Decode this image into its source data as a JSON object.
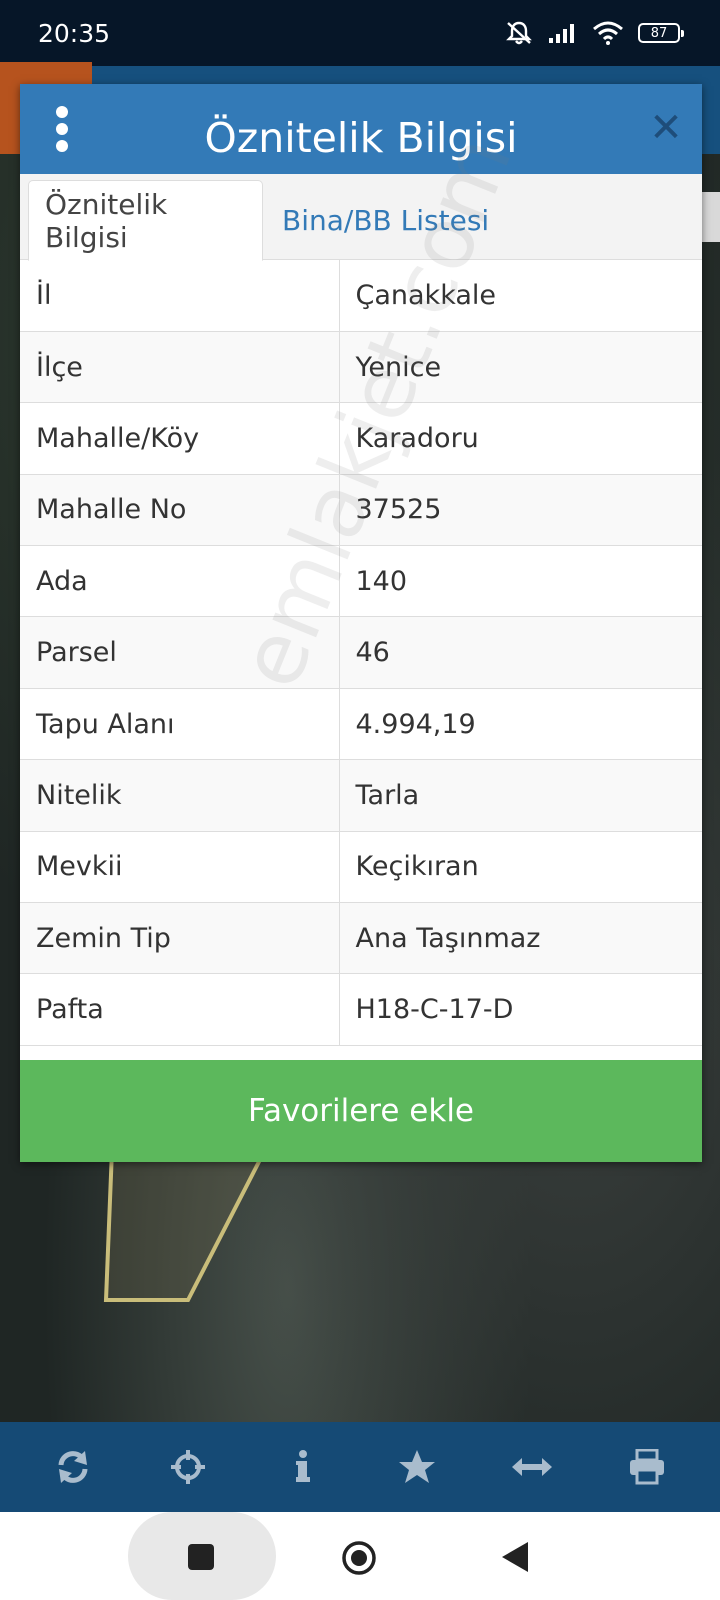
{
  "status_bar": {
    "time": "20:35",
    "battery": "87"
  },
  "dialog": {
    "title": "Öznitelik Bilgisi",
    "tabs": [
      {
        "label": "Öznitelik Bilgisi",
        "active": true
      },
      {
        "label": "Bina/BB Listesi",
        "active": false
      }
    ],
    "rows": [
      {
        "key": "İl",
        "value": "Çanakkale"
      },
      {
        "key": "İlçe",
        "value": "Yenice"
      },
      {
        "key": "Mahalle/Köy",
        "value": "Karadoru"
      },
      {
        "key": "Mahalle No",
        "value": "37525"
      },
      {
        "key": "Ada",
        "value": "140"
      },
      {
        "key": "Parsel",
        "value": "46"
      },
      {
        "key": "Tapu Alanı",
        "value": "4.994,19"
      },
      {
        "key": "Nitelik",
        "value": "Tarla"
      },
      {
        "key": "Mevkii",
        "value": "Keçikıran"
      },
      {
        "key": "Zemin Tip",
        "value": "Ana Taşınmaz"
      },
      {
        "key": "Pafta",
        "value": "H18-C-17-D"
      }
    ],
    "favorite_button": "Favorilere ekle",
    "watermark": "emlakjet.com"
  },
  "toolbar": {
    "icons": [
      "refresh-icon",
      "crosshair-icon",
      "info-icon",
      "star-icon",
      "resize-horizontal-icon",
      "print-icon"
    ]
  },
  "nav_bar": {
    "icons": [
      "recent-apps-icon",
      "home-icon",
      "back-icon"
    ]
  },
  "colors": {
    "header_blue": "#337ab7",
    "toolbar_blue": "#154a75",
    "button_green": "#5cb85c",
    "status_bar": "#061628"
  }
}
